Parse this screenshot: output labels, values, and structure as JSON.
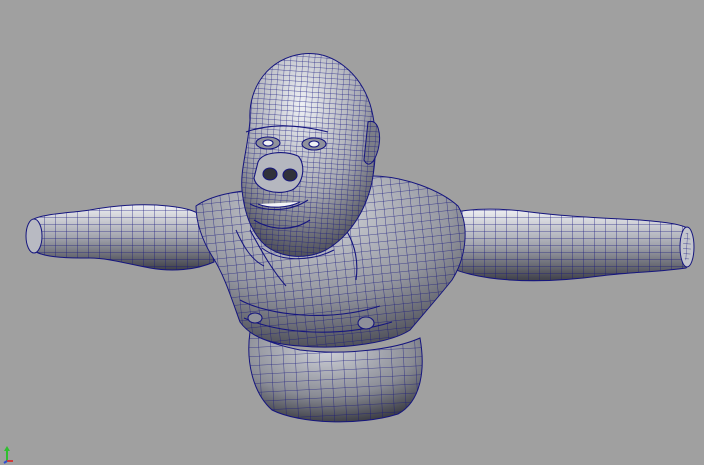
{
  "viewport": {
    "background_color": "#a0a0a0",
    "view": "perspective",
    "shading": "smooth-shaded-with-wireframe",
    "mesh_color": "#c9cbd2",
    "mesh_shadow_color": "#3d3e47",
    "wire_color": "#15157e"
  },
  "model": {
    "subject": "gorilla-bust-t-pose",
    "parts": [
      "head",
      "face",
      "left-ear",
      "right-ear",
      "nose",
      "mouth",
      "torso",
      "left-arm",
      "right-arm",
      "chest",
      "belly",
      "base"
    ]
  },
  "axis_gizmo": {
    "axes": [
      {
        "name": "y",
        "color": "#2fbf2f"
      },
      {
        "name": "x",
        "color": "#d23b3b"
      },
      {
        "name": "z",
        "color": "#2f4fd2"
      }
    ]
  }
}
